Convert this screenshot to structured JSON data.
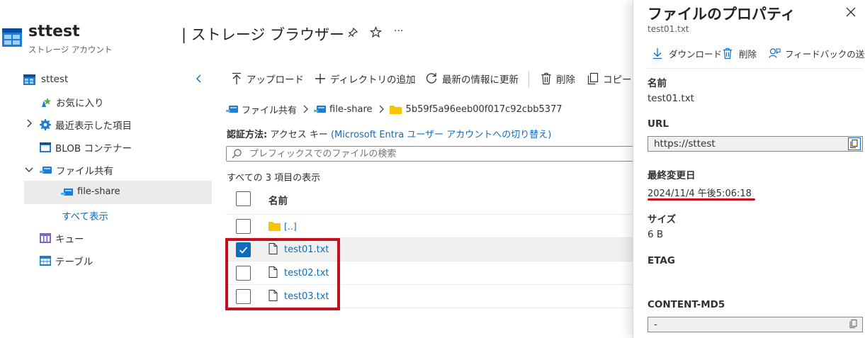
{
  "header": {
    "account_name": "sttest",
    "account_type": "ストレージ アカウント",
    "page_title": "| ストレージ ブラウザー",
    "more": "···"
  },
  "sidebar": {
    "root": "sttest",
    "items": [
      {
        "label": "お気に入り"
      },
      {
        "label": "最近表示した項目"
      },
      {
        "label": "BLOB コンテナー"
      },
      {
        "label": "ファイル共有"
      },
      {
        "label": "file-share"
      },
      {
        "label": "すべて表示"
      },
      {
        "label": "キュー"
      },
      {
        "label": "テーブル"
      }
    ]
  },
  "toolbar": {
    "upload": "アップロード",
    "add_directory": "ディレクトリの追加",
    "refresh": "最新の情報に更新",
    "delete": "削除",
    "copy": "コピー"
  },
  "breadcrumb": {
    "root": "ファイル共有",
    "share": "file-share",
    "folder": "5b59f5a96eeb00f017c92cbb5377"
  },
  "auth": {
    "label": "認証方法:",
    "value": "アクセス キー",
    "switch_link": "(Microsoft Entra ユーザー アカウントへの切り替え)"
  },
  "search": {
    "placeholder": "プレフィックスでのファイルの検索"
  },
  "list": {
    "count_text": "すべての 3 項目の表示",
    "column_name": "名前",
    "parent": "[..]",
    "files": [
      {
        "name": "test01.txt",
        "checked": true
      },
      {
        "name": "test02.txt",
        "checked": false
      },
      {
        "name": "test03.txt",
        "checked": false
      }
    ]
  },
  "panel": {
    "title": "ファイルのプロパティ",
    "subtitle": "test01.txt",
    "actions": {
      "download": "ダウンロード",
      "delete": "削除",
      "feedback": "フィードバックの送信"
    },
    "name_label": "名前",
    "name_value": "test01.txt",
    "url_label": "URL",
    "url_value": "https://sttest",
    "modified_label": "最終変更日",
    "modified_value": "2024/11/4 午後5:06:18",
    "size_label": "サイズ",
    "size_value": "6 B",
    "etag_label": "ETAG",
    "md5_label": "CONTENT-MD5",
    "md5_value": "-"
  },
  "colors": {
    "accent": "#0f6cbd",
    "highlight_red": "#c50f1f",
    "folder_yellow": "#f8c400",
    "azure_blue": "#1e7bd6"
  }
}
